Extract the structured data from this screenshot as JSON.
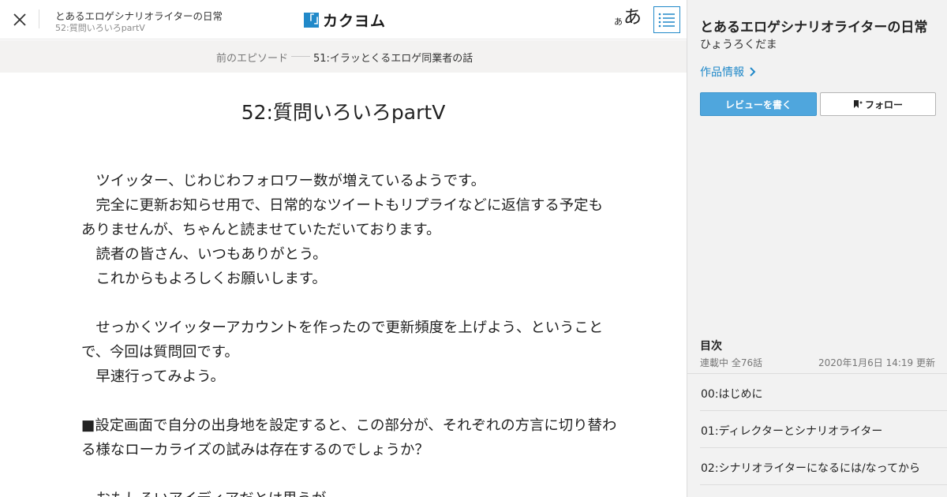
{
  "header": {
    "work_title": "とあるエロゲシナリオライターの日常",
    "episode_sub": "52:質問いろいろpartⅤ",
    "logo_mark": "「」",
    "logo_text": "カクヨム",
    "font_small": "あ",
    "font_large": "あ",
    "icons": [
      "close-icon",
      "toc-list-icon"
    ],
    "accent_color": "#2189c9"
  },
  "prev_bar": {
    "label": "前のエピソード",
    "title": "51:イラッとくるエロゲ同業者の話"
  },
  "episode": {
    "title": "52:質問いろいろpartⅤ",
    "lines": [
      "",
      "",
      "　ツイッター、じわじわフォロワー数が増えているようです。",
      "　完全に更新お知らせ用で、日常的なツイートもリプライなどに返信する予定も",
      "ありませんが、ちゃんと読ませていただいております。",
      "　読者の皆さん、いつもありがとう。",
      "　これからもよろしくお願いします。",
      "",
      "　せっかくツイッターアカウントを作ったので更新頻度を上げよう、ということ",
      "で、今回は質問回です。",
      "　早速行ってみよう。",
      "",
      "■設定画面で自分の出身地を設定すると、この部分が、それぞれの方言に切り替わ",
      "る様なローカライズの試みは存在するのでしょうか？",
      "",
      "　おもしろいアイディアだとは思うが"
    ]
  },
  "sidebar": {
    "title": "とあるエロゲシナリオライターの日常",
    "author": "ひょうろくだま",
    "info_link": "作品情報",
    "review_button": "レビューを書く",
    "follow_button": "フォロー",
    "toc_heading": "目次",
    "toc_status": "連載中 全76話",
    "toc_updated": "2020年1月6日 14:19 更新",
    "toc_items": [
      "00:はじめに",
      "01:ディレクターとシナリオライター",
      "02:シナリオライターになるには/なってから"
    ]
  }
}
